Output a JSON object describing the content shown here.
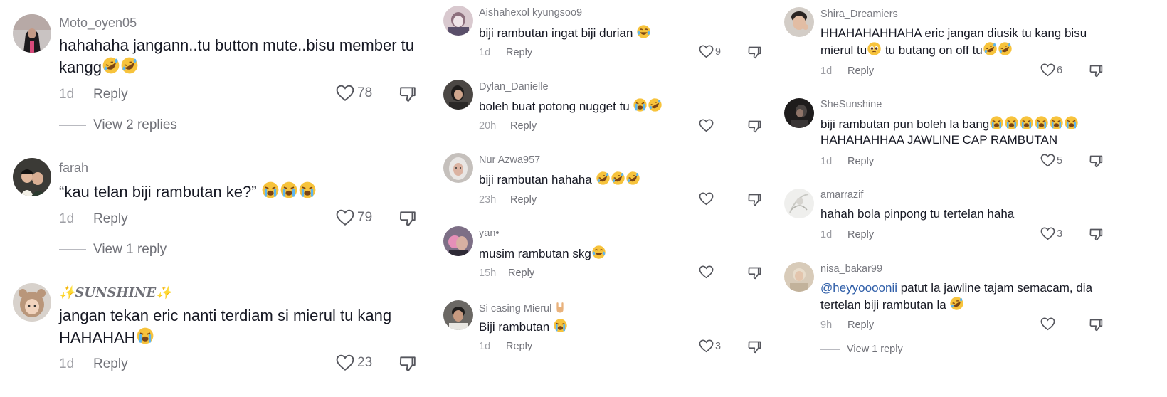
{
  "icons": {
    "like": "heart-outline-icon",
    "dislike": "thumbs-down-icon",
    "laugh_cry": "rolling-on-floor-laughing-emoji",
    "loud_cry": "loudly-crying-face-emoji",
    "tears_joy": "face-with-tears-of-joy-emoji",
    "pleading": "pleading-face-emoji",
    "rock_hand": "sign-of-the-horns-emoji"
  },
  "colors": {
    "text": "#161823",
    "muted": "#9d9ea4",
    "mention": "#2f5ea8",
    "background": "#ffffff"
  },
  "reply_label": "Reply",
  "col1": [
    {
      "username": "Moto_oyen05",
      "text": "hahahaha jangann..tu button mute..bisu member tu kangg",
      "emojis": [
        "laugh_cry",
        "laugh_cry"
      ],
      "age": "1d",
      "likes": "78",
      "view_replies": "View 2 replies"
    },
    {
      "username": "farah",
      "text": "“kau telan biji rambutan ke?” ",
      "emojis": [
        "loud_cry",
        "loud_cry",
        "loud_cry"
      ],
      "age": "1d",
      "likes": "79",
      "view_replies": "View 1 reply"
    },
    {
      "username": "✨𝑺𝑼𝑵𝑺𝑯𝑰𝑵𝑬✨",
      "text": "jangan tekan eric nanti terdiam si mierul tu kang HAHAHAH",
      "emojis": [
        "loud_cry"
      ],
      "age": "1d",
      "likes": "23"
    }
  ],
  "col2": [
    {
      "username": "Aishahexol kyungsoo9",
      "text": "biji rambutan ingat biji durian ",
      "emojis": [
        "tears_joy"
      ],
      "age": "1d",
      "likes": "9"
    },
    {
      "username": "Dylan_Danielle",
      "text": "boleh buat potong nugget tu ",
      "emojis": [
        "loud_cry",
        "laugh_cry"
      ],
      "age": "20h",
      "likes": ""
    },
    {
      "username": "Nur Azwa957",
      "text": "biji rambutan hahaha ",
      "emojis": [
        "laugh_cry",
        "laugh_cry",
        "laugh_cry"
      ],
      "age": "23h",
      "likes": ""
    },
    {
      "username": "yan•",
      "text": "musim rambutan skg",
      "emojis": [
        "tears_joy"
      ],
      "age": "15h",
      "likes": ""
    },
    {
      "username": "Si casing Mierul ",
      "username_emoji": "rock_hand",
      "text": "Biji rambutan ",
      "emojis": [
        "loud_cry"
      ],
      "age": "1d",
      "likes": "3"
    }
  ],
  "col3": [
    {
      "username": "Shira_Dreamiers",
      "text_parts": [
        "HHAHAHAHHAHA eric jangan diusik tu kang bisu mierul tu",
        " tu butang on off tu"
      ],
      "mid_emoji": "pleading",
      "emojis": [
        "laugh_cry",
        "laugh_cry"
      ],
      "age": "1d",
      "likes": "6"
    },
    {
      "username": "SheSunshine",
      "text_parts": [
        "biji rambutan pun boleh la bang",
        " HAHAHAHHAA JAWLINE CAP RAMBUTAN"
      ],
      "mid_emojis": [
        "loud_cry",
        "loud_cry",
        "loud_cry",
        "loud_cry",
        "loud_cry",
        "loud_cry"
      ],
      "age": "1d",
      "likes": "5"
    },
    {
      "username": "amarrazif",
      "text": "hahah bola pinpong tu tertelan haha",
      "age": "1d",
      "likes": "3"
    },
    {
      "username": "nisa_bakar99",
      "mention": "@heyyoooonii",
      "text": " patut la jawline tajam semacam, dia tertelan biji rambutan la ",
      "emojis": [
        "laugh_cry"
      ],
      "age": "9h",
      "likes": "",
      "view_replies": "View 1 reply"
    }
  ]
}
